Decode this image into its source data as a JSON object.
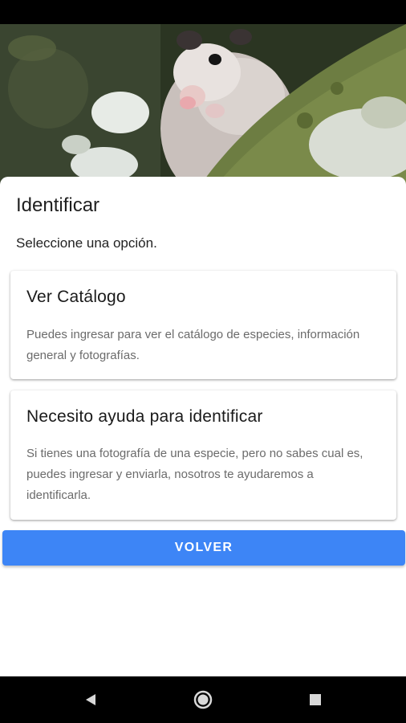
{
  "hero": {
    "image": "opossum-photo"
  },
  "sheet": {
    "title": "Identificar",
    "subtitle": "Seleccione una opción."
  },
  "options": [
    {
      "title": "Ver Catálogo",
      "description": "Puedes ingresar para ver el catálogo de especies, información general y fotografías."
    },
    {
      "title": "Necesito ayuda para identificar",
      "description": "Si tienes una fotografía de una especie, pero no sabes cual es, puedes ingresar y enviarla, nosotros te ayudaremos a identificarla."
    }
  ],
  "back_button": {
    "label": "VOLVER"
  },
  "nav": {
    "icons": [
      "back-triangle-icon",
      "home-circle-icon",
      "recents-square-icon"
    ]
  },
  "colors": {
    "accent": "#3d85f6",
    "system_bars": "#000000",
    "card_text_secondary": "#6b6b6b"
  }
}
